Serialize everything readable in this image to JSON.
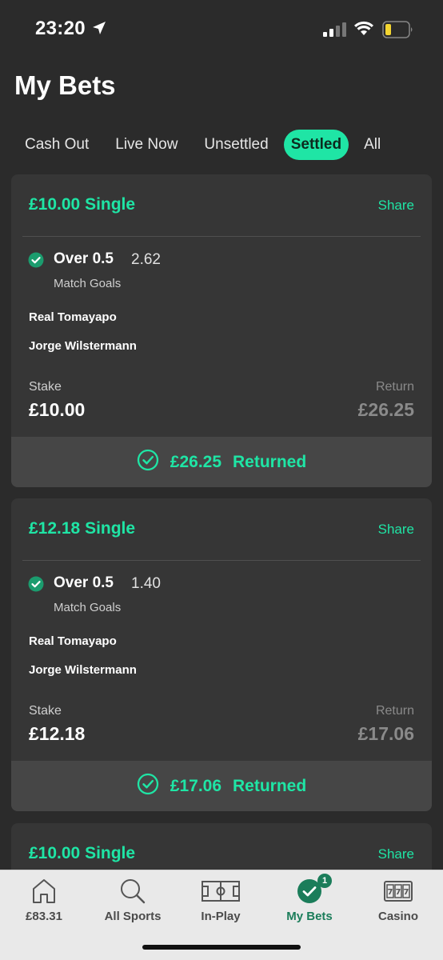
{
  "status": {
    "time": "23:20"
  },
  "page": {
    "title": "My Bets"
  },
  "tabs": [
    {
      "label": "Cash Out",
      "active": false
    },
    {
      "label": "Live Now",
      "active": false
    },
    {
      "label": "Unsettled",
      "active": false
    },
    {
      "label": "Settled",
      "active": true
    },
    {
      "label": "All",
      "active": false
    }
  ],
  "bets": [
    {
      "title": "£10.00 Single",
      "share": "Share",
      "selection": "Over 0.5",
      "odds": "2.62",
      "market": "Match Goals",
      "team1": "Real Tomayapo",
      "team2": "Jorge Wilstermann",
      "stake_label": "Stake",
      "stake": "£10.00",
      "return_label": "Return",
      "return": "£26.25",
      "returned_amount": "£26.25",
      "returned_text": "Returned"
    },
    {
      "title": "£12.18 Single",
      "share": "Share",
      "selection": "Over 0.5",
      "odds": "1.40",
      "market": "Match Goals",
      "team1": "Real Tomayapo",
      "team2": "Jorge Wilstermann",
      "stake_label": "Stake",
      "stake": "£12.18",
      "return_label": "Return",
      "return": "£17.06",
      "returned_amount": "£17.06",
      "returned_text": "Returned"
    },
    {
      "title": "£10.00 Single",
      "share": "Share"
    }
  ],
  "nav": [
    {
      "label": "£83.31",
      "icon": "home-icon"
    },
    {
      "label": "All Sports",
      "icon": "search-icon"
    },
    {
      "label": "In-Play",
      "icon": "pitch-icon"
    },
    {
      "label": "My Bets",
      "icon": "check-circle-icon",
      "active": true,
      "badge": "1"
    },
    {
      "label": "Casino",
      "icon": "slot-machine-icon"
    }
  ],
  "colors": {
    "accent": "#1fe5a5",
    "background": "#2b2b2b",
    "card": "#363636",
    "nav_active": "#1b7d5a"
  }
}
